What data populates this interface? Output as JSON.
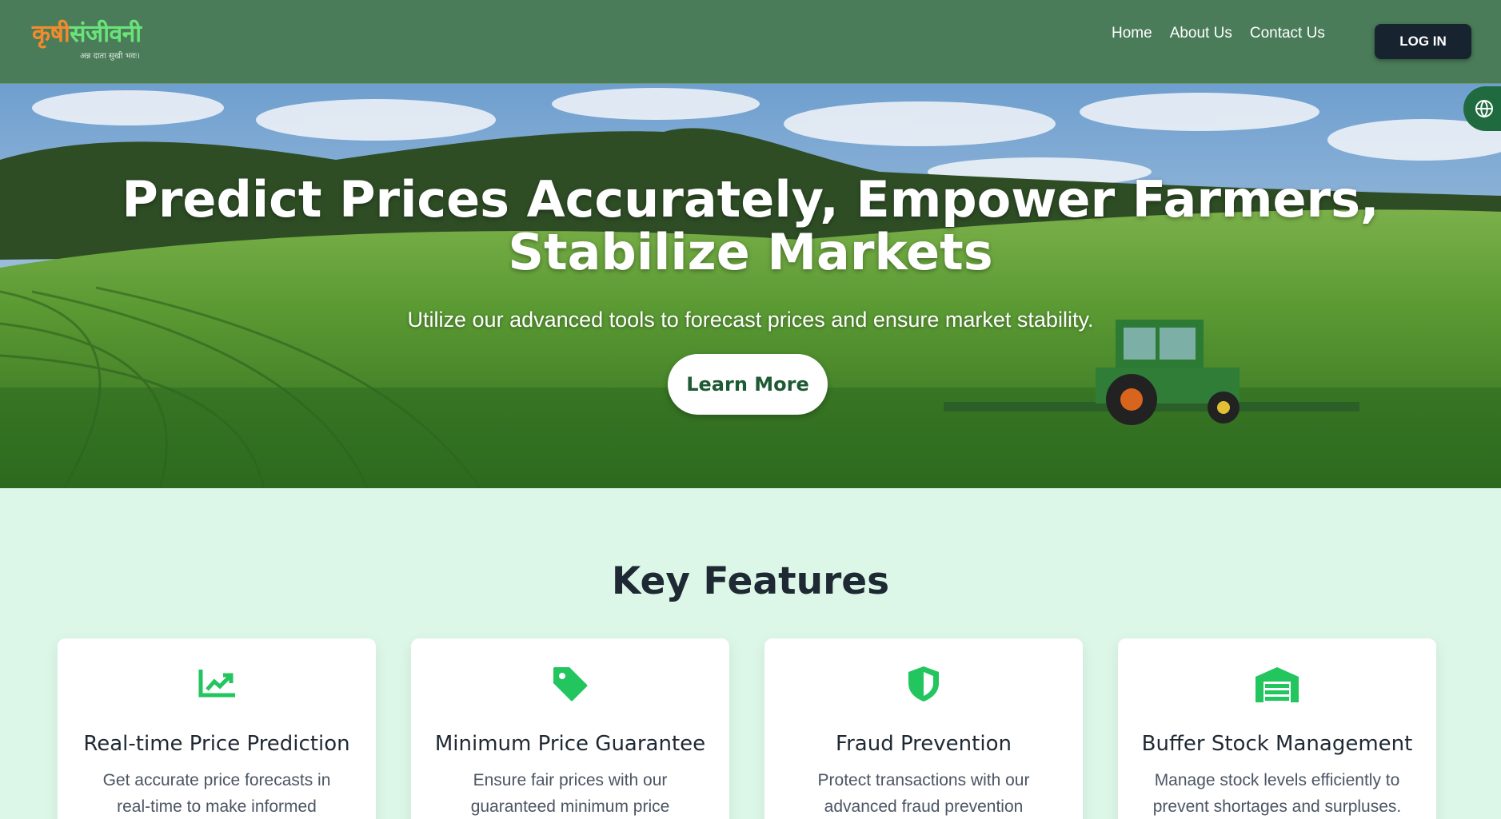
{
  "header": {
    "logo_part1": "कृषी",
    "logo_part2": "संजीवनी",
    "logo_tagline": "अन्न दाता सुखी भवः।",
    "nav": [
      "Home",
      "About Us",
      "Contact Us"
    ],
    "login_label": "LOG IN"
  },
  "hero": {
    "title": "Predict Prices Accurately, Empower Farmers, Stabilize Markets",
    "subtitle": "Utilize our advanced tools to forecast prices and ensure market stability.",
    "cta_label": "Learn More"
  },
  "features": {
    "title": "Key Features",
    "cards": [
      {
        "icon": "chart-line-icon",
        "title": "Real-time Price Prediction",
        "text": "Get accurate price forecasts in real-time to make informed"
      },
      {
        "icon": "price-tag-icon",
        "title": "Minimum Price Guarantee",
        "text": "Ensure fair prices with our guaranteed minimum price"
      },
      {
        "icon": "shield-icon",
        "title": "Fraud Prevention",
        "text": "Protect transactions with our advanced fraud prevention"
      },
      {
        "icon": "warehouse-icon",
        "title": "Buffer Stock Management",
        "text": "Manage stock levels efficiently to prevent shortages and surpluses."
      }
    ]
  },
  "colors": {
    "header_bg": "#4a7c59",
    "accent_green": "#22c55e",
    "page_bg": "#dcf7e8",
    "login_bg": "#17232f"
  }
}
